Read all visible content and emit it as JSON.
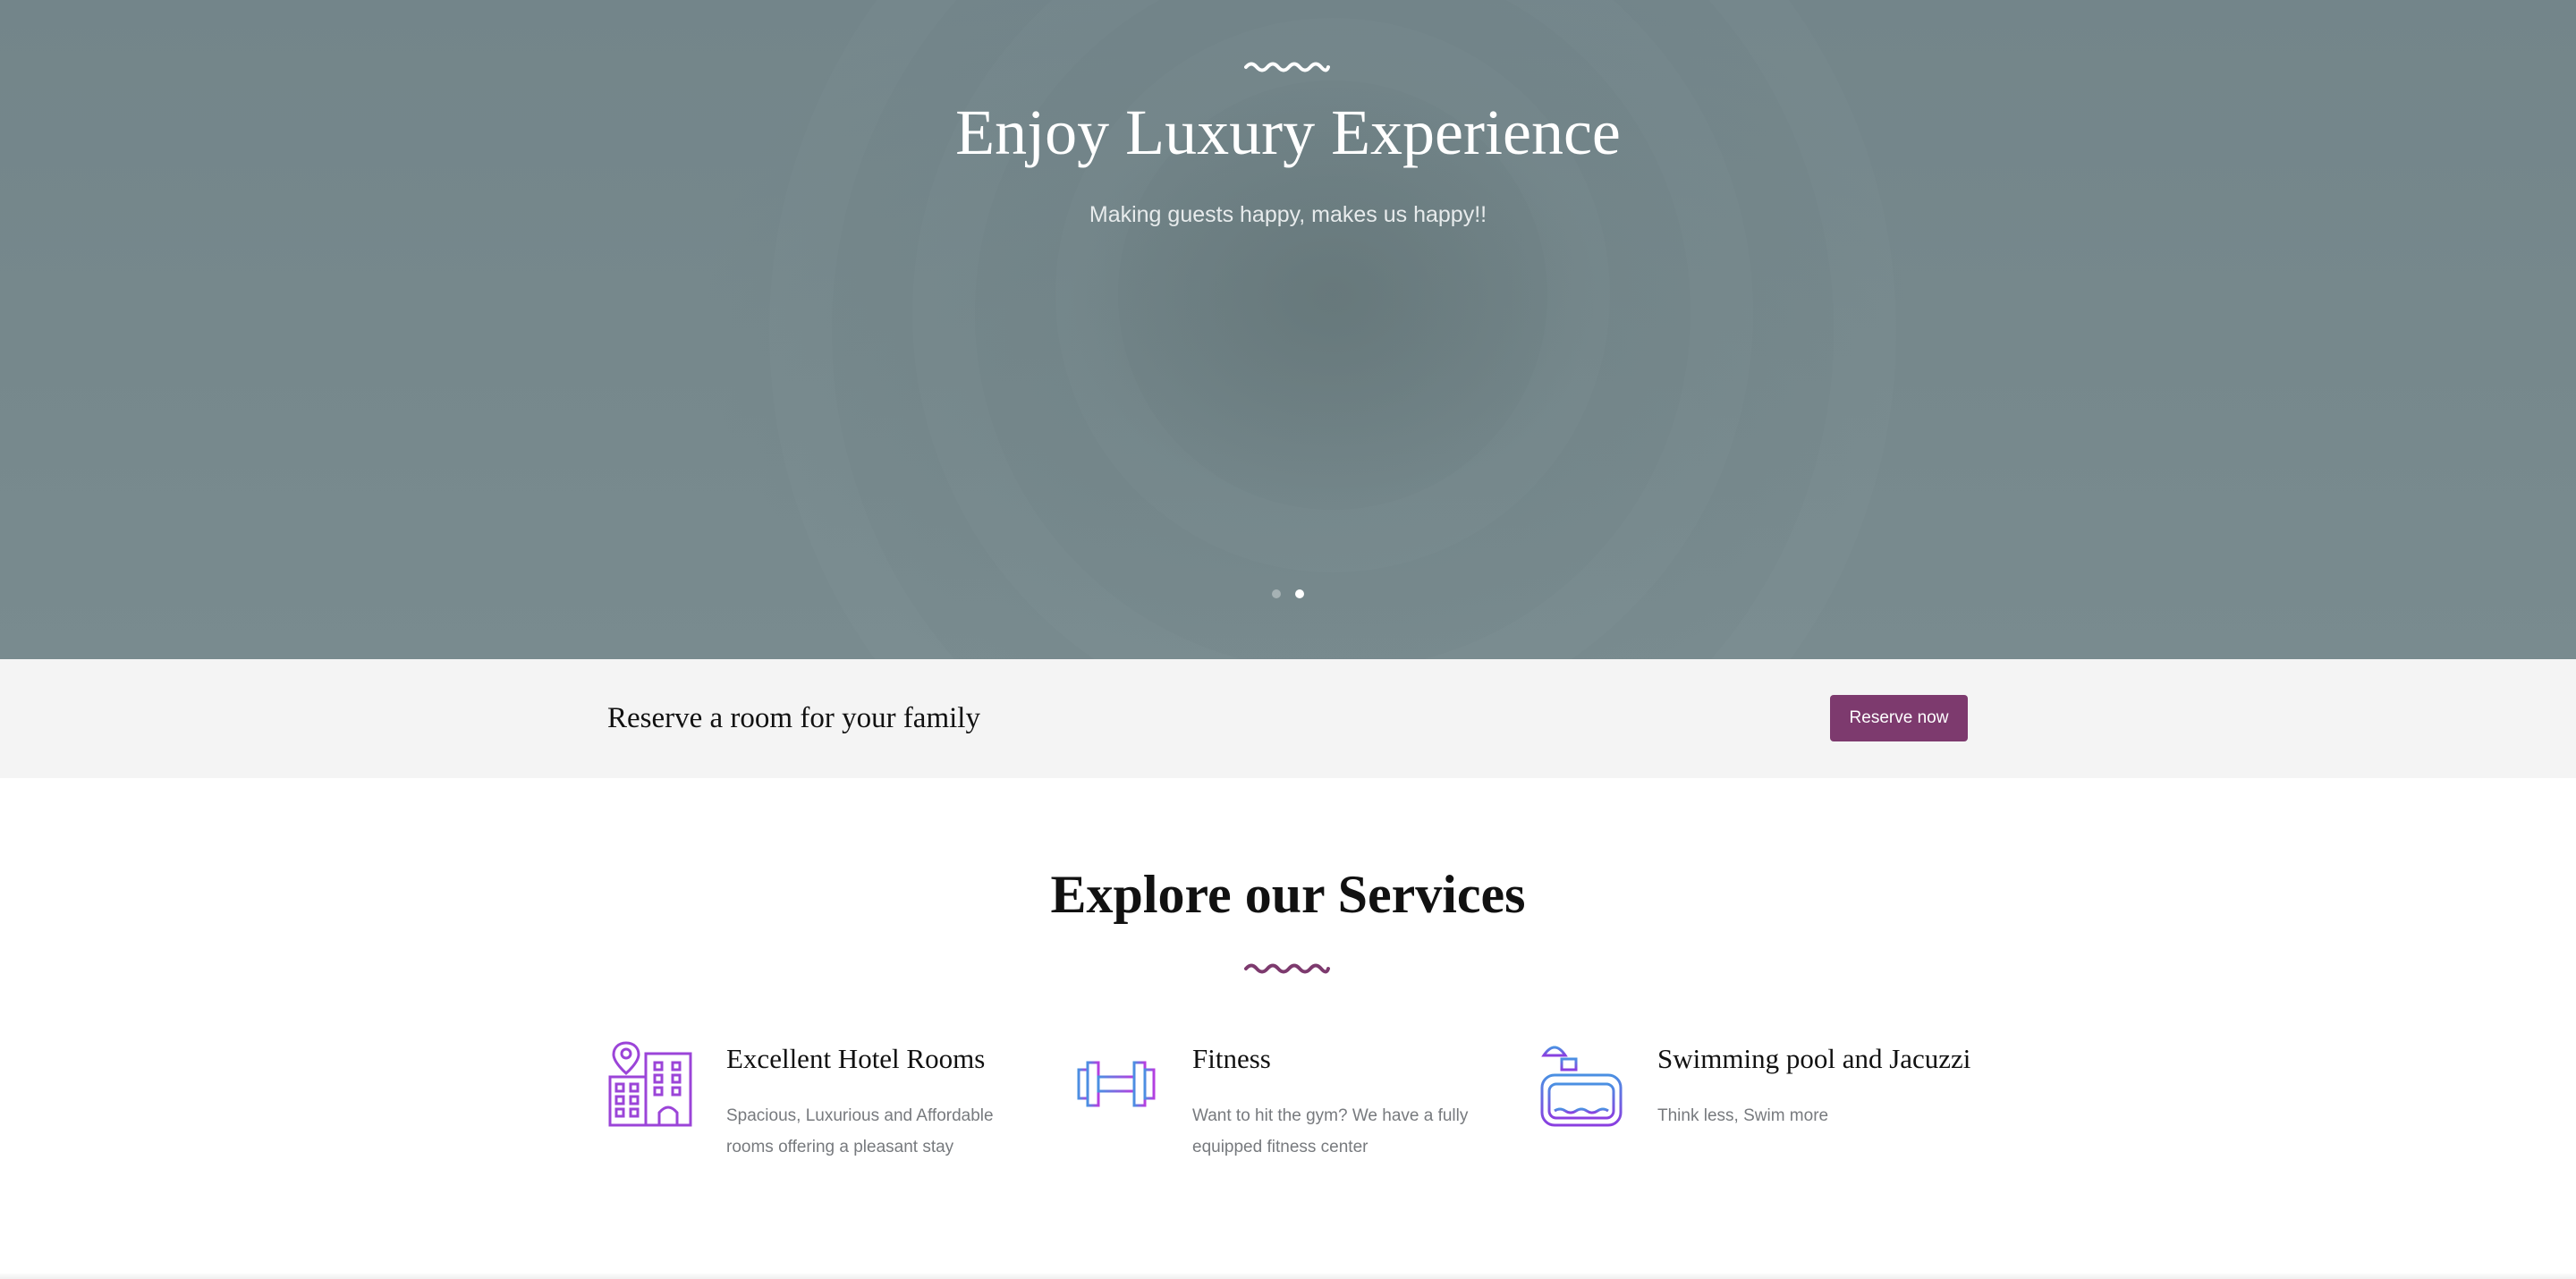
{
  "hero": {
    "title": "Enjoy Luxury Experience",
    "subtitle": "Making guests happy, makes us happy!!",
    "slides": 2,
    "active_slide": 2
  },
  "reserve": {
    "text": "Reserve a room for your family",
    "button_label": "Reserve now"
  },
  "services": {
    "heading": "Explore our Services",
    "items": [
      {
        "icon": "hotel-building-icon",
        "title": "Excellent Hotel Rooms",
        "description": "Spacious, Luxurious and Affordable rooms offering a pleasant stay"
      },
      {
        "icon": "dumbbell-icon",
        "title": "Fitness",
        "description": "Want to hit the gym? We have a fully equipped fitness center"
      },
      {
        "icon": "swimming-pool-icon",
        "title": "Swimming pool and Jacuzzi",
        "description": "Think less, Swim more"
      }
    ]
  },
  "colors": {
    "accent": "#7d3a6e",
    "reserve_bar_bg": "#f4f4f4",
    "hero_bg": "#76888c",
    "icon_gradient_start": "#4a90e2",
    "icon_gradient_end": "#b63ee0"
  }
}
